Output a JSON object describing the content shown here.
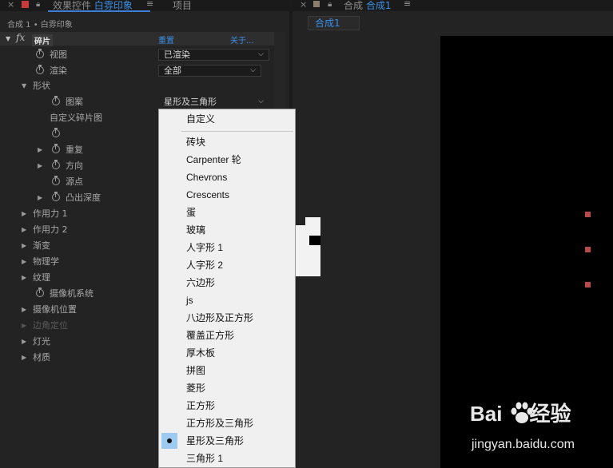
{
  "left_panel": {
    "tab_effect_controls_prefix": "效果控件",
    "tab_effect_controls_layer": "白雰印象",
    "tab_project": "项目",
    "breadcrumb": "合成 1 • 白雰印象",
    "effect": {
      "name": "碎片",
      "reset_label": "重置",
      "about_label": "关于..."
    },
    "properties": [
      {
        "label": "视图",
        "value": "已渲染"
      },
      {
        "label": "渲染",
        "value": "全部"
      },
      {
        "label": "形状"
      },
      {
        "label": "图案",
        "value": "星形及三角形"
      },
      {
        "label": "自定义碎片图"
      },
      {
        "label": ""
      },
      {
        "label": "重复"
      },
      {
        "label": "方向"
      },
      {
        "label": "源点"
      },
      {
        "label": "凸出深度"
      },
      {
        "label": "作用力 1"
      },
      {
        "label": "作用力 2"
      },
      {
        "label": "渐变"
      },
      {
        "label": "物理学"
      },
      {
        "label": "纹理"
      },
      {
        "label": "摄像机系统"
      },
      {
        "label": "摄像机位置"
      },
      {
        "label": "边角定位"
      },
      {
        "label": "灯光"
      },
      {
        "label": "材质"
      }
    ]
  },
  "right_panel": {
    "tab_prefix": "合成",
    "tab_comp": "合成1",
    "comp_chip": "合成1"
  },
  "dropdown_menu": {
    "items": [
      "自定义",
      "砖块",
      "Carpenter 轮",
      "Chevrons",
      "Crescents",
      "蛋",
      "玻璃",
      "人字形 1",
      "人字形 2",
      "六边形",
      "js",
      "八边形及正方形",
      "覆盖正方形",
      "厚木板",
      "拼图",
      "菱形",
      "正方形",
      "正方形及三角形",
      "星形及三角形",
      "三角形 1"
    ],
    "selected": "星形及三角形"
  },
  "watermark": {
    "brand": "Bai 经验",
    "url": "jingyan.baidu.com"
  },
  "colors": {
    "accent_blue": "#3b8fe6",
    "panel_bg": "#232323",
    "menu_bg": "#f0f0f0",
    "selection": "#9ec9f0",
    "handle_red": "#b94848"
  }
}
